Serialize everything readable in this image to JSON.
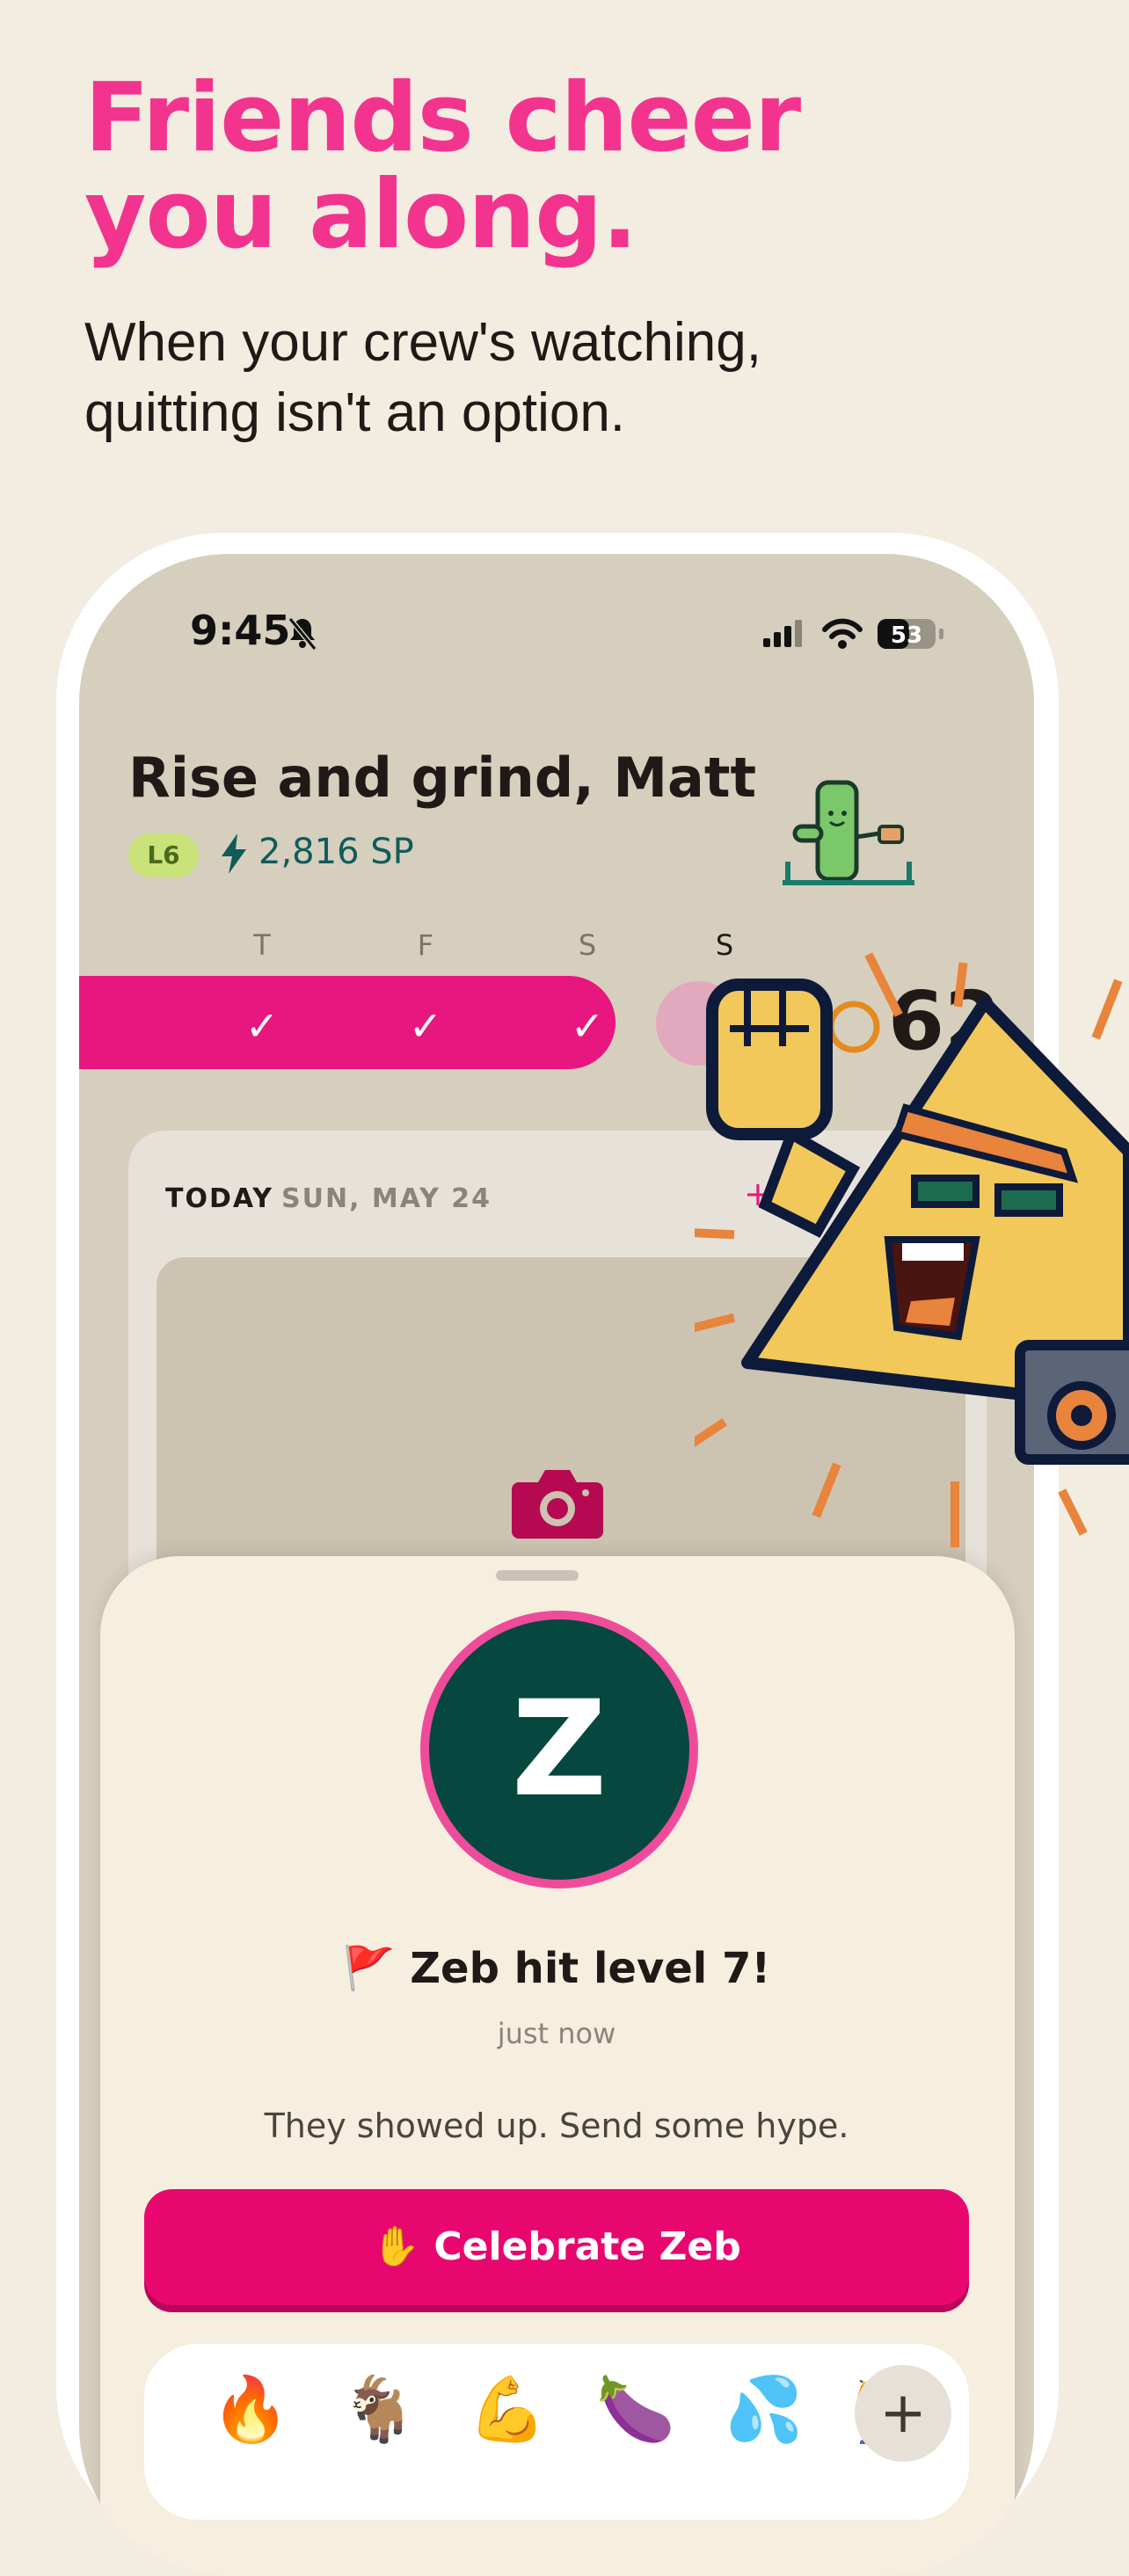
{
  "headline": {
    "title_line1": "Friends cheer",
    "title_line2": "you along.",
    "subtitle_line1": "When your crew's watching,",
    "subtitle_line2": "quitting isn't an option."
  },
  "phone": {
    "status_bar": {
      "time": "9:45",
      "battery": "53"
    },
    "greeting": "Rise and grind, Matt",
    "level": "L6",
    "points": "2,816 SP",
    "week_days": [
      "T",
      "F",
      "S",
      "S"
    ],
    "checks": [
      "✓",
      "✓",
      "✓"
    ],
    "streak_count": "62",
    "today_card": {
      "label": "TODAY",
      "date": "SUN, MAY 24",
      "add": "+"
    },
    "sheet": {
      "avatar_letter": "Z",
      "flag": "🚩",
      "title": "Zeb hit level 7!",
      "time": "just now",
      "message": "They showed up. Send some hype.",
      "button_icon": "✋",
      "button_label": "Celebrate Zeb",
      "emojis": [
        "🔥",
        "🐐",
        "💪",
        "🍆",
        "💦",
        "🏌"
      ],
      "plus": "+"
    }
  },
  "colors": {
    "accent_pink": "#F2348F",
    "button_pink": "#E8076F",
    "avatar_teal": "#06473F",
    "background": "#F3ECE0"
  }
}
